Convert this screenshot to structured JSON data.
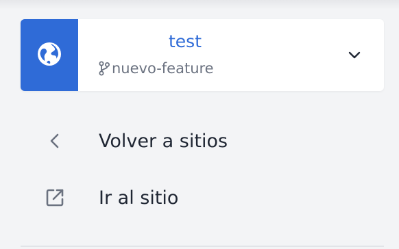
{
  "site": {
    "name": "test",
    "branch": "nuevo-feature",
    "avatar_icon": "globe-icon",
    "accent_color": "#2f6bd7"
  },
  "nav": {
    "back_label": "Volver a sitios",
    "go_label": "Ir al sitio"
  }
}
